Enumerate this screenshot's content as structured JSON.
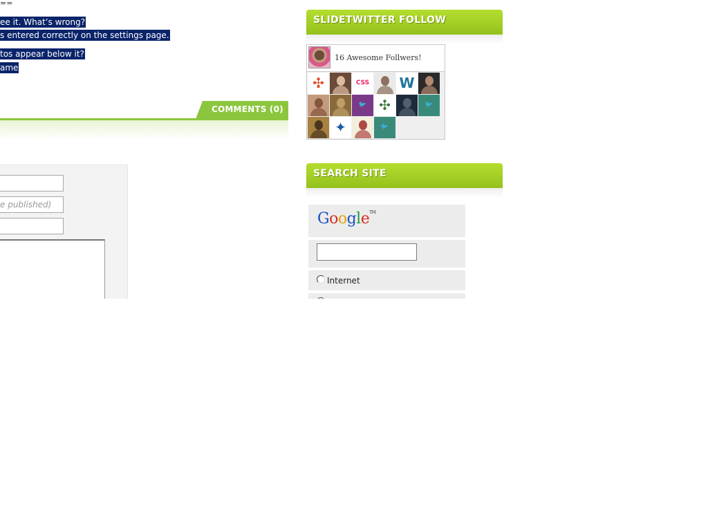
{
  "article": {
    "eq_mark": "==",
    "lines": [
      "ee it. What’s wrong?",
      "s entered correctly on the settings page.",
      "tos appear below it?",
      "ame"
    ]
  },
  "comments": {
    "tab_label": "COMMENTS (0)"
  },
  "comment_form": {
    "name_value": "",
    "email_placeholder": "e published)",
    "website_value": "",
    "message_value": ""
  },
  "sidebar": {
    "follow_title": "SLIDETWITTER FOLLOW",
    "follow_text": "16 Awesome Follwers!",
    "followers": [
      {
        "icon": "joomla-icon",
        "bg": "#ffffff",
        "fg": "#e44d26",
        "glyph": "✣"
      },
      {
        "icon": "person-icon",
        "bg": "#6b4a3a",
        "fg": "#f0d0b0",
        "glyph": ""
      },
      {
        "icon": "css-icon",
        "bg": "#ffffff",
        "fg": "#e91e63",
        "glyph": "CSS"
      },
      {
        "icon": "person-icon",
        "bg": "#e9e9e9",
        "fg": "#7a5a44",
        "glyph": ""
      },
      {
        "icon": "wordpress-icon",
        "bg": "#ffffff",
        "fg": "#21759b",
        "glyph": "W"
      },
      {
        "icon": "person-icon",
        "bg": "#2a2a2a",
        "fg": "#c99a7a",
        "glyph": ""
      },
      {
        "icon": "person-icon",
        "bg": "#c49a7c",
        "fg": "#7a4a30",
        "glyph": ""
      },
      {
        "icon": "photo-icon",
        "bg": "#8a6a3a",
        "fg": "#c8a870",
        "glyph": ""
      },
      {
        "icon": "twitter-bird-icon",
        "bg": "#7a3a8a",
        "fg": "#ffffff",
        "glyph": "🐦"
      },
      {
        "icon": "joomla-icon",
        "bg": "#ffffff",
        "fg": "#3a7a3a",
        "glyph": "✣"
      },
      {
        "icon": "photo-icon",
        "bg": "#1e2a3a",
        "fg": "#5a6a7a",
        "glyph": ""
      },
      {
        "icon": "twitter-bird-icon",
        "bg": "#3a8a7a",
        "fg": "#ffffff",
        "glyph": "🐦"
      },
      {
        "icon": "photo-icon",
        "bg": "#a88040",
        "fg": "#3a2a1a",
        "glyph": ""
      },
      {
        "icon": "logo-icon",
        "bg": "#ffffff",
        "fg": "#1a5aa0",
        "glyph": "✦"
      },
      {
        "icon": "book-icon",
        "bg": "#f3efdd",
        "fg": "#a02a2a",
        "glyph": ""
      },
      {
        "icon": "twitter-bird-icon",
        "bg": "#3a8a7a",
        "fg": "#ffffff",
        "glyph": "🐦"
      }
    ],
    "search_title": "SEARCH SITE",
    "google_logo": "Google",
    "google_tm": "TM",
    "search_value": "",
    "radio_internet": "Internet"
  }
}
